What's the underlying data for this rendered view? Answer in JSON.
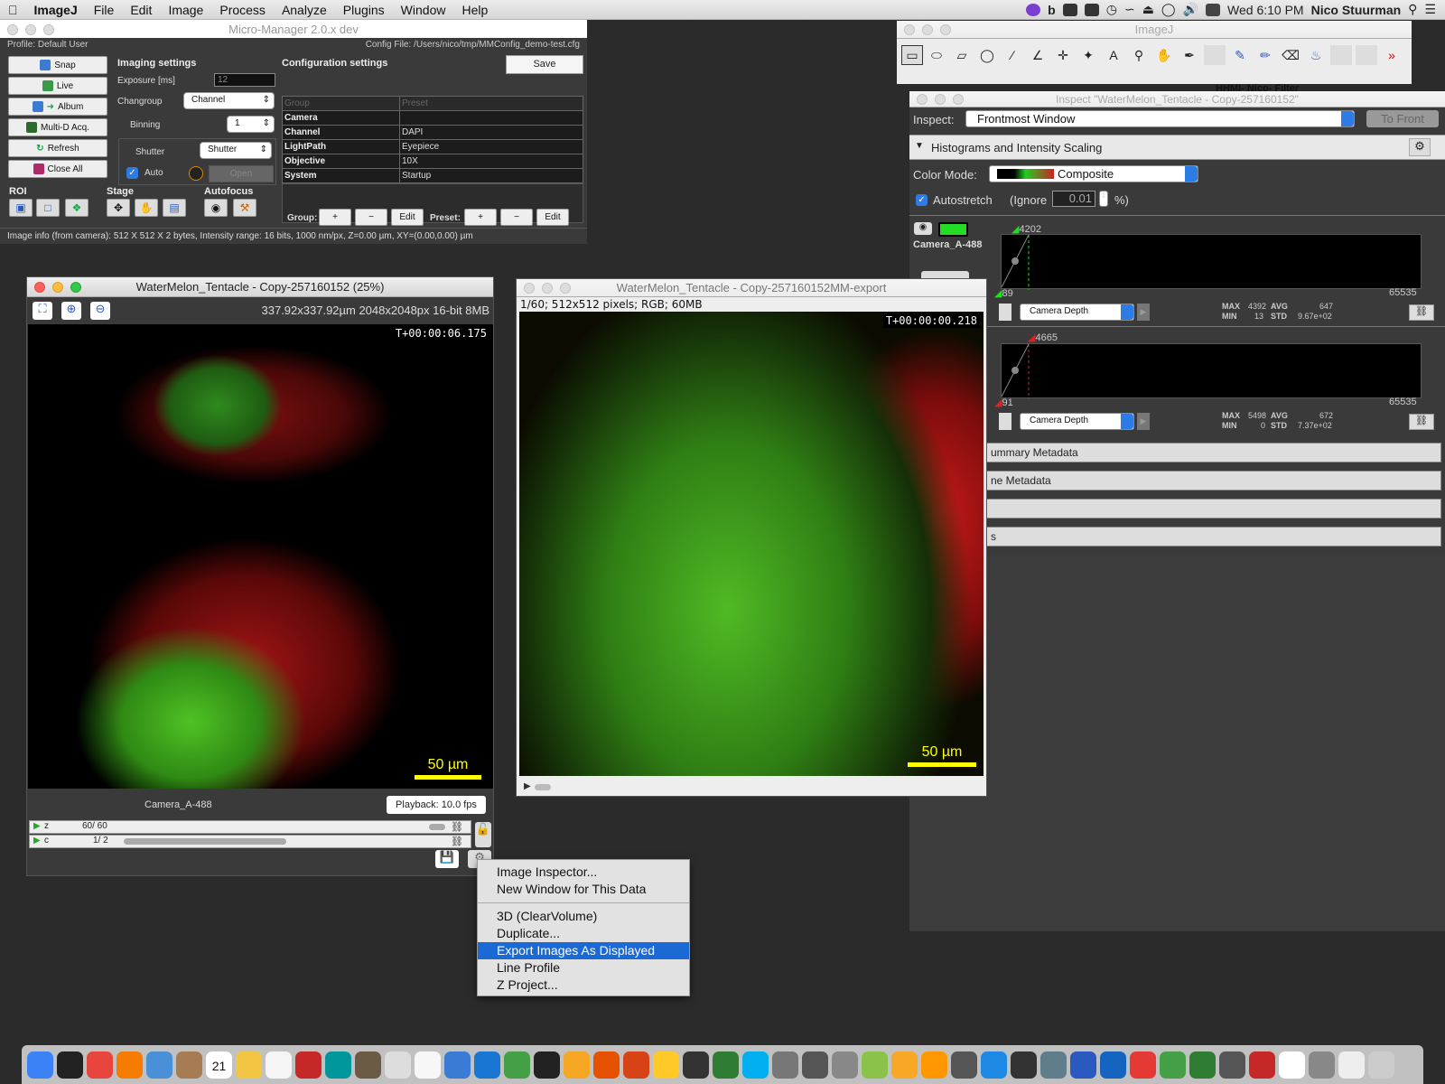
{
  "menubar": {
    "apple": "",
    "app": "ImageJ",
    "items": [
      "File",
      "Edit",
      "Image",
      "Process",
      "Analyze",
      "Plugins",
      "Window",
      "Help"
    ],
    "clock": "Wed 6:10 PM",
    "user": "Nico Stuurman"
  },
  "micromanager": {
    "title": "Micro-Manager 2.0.x dev",
    "profile": "Profile: Default User",
    "config_file": "Config File: /Users/nico/tmp/MMConfig_demo-test.cfg",
    "buttons": {
      "snap": "Snap",
      "live": "Live",
      "album": "Album",
      "mda": "Multi-D Acq.",
      "refresh": "Refresh",
      "close_all": "Close All"
    },
    "imaging_title": "Imaging settings",
    "exposure_label": "Exposure [ms]",
    "exposure_value": "12",
    "changroup_label": "Changroup",
    "changroup_value": "Channel",
    "binning_label": "Binning",
    "binning_value": "1",
    "shutter_label": "Shutter",
    "shutter_value": "Shutter",
    "auto_label": "Auto",
    "open_label": "Open",
    "config_title": "Configuration settings",
    "save_label": "Save",
    "table_header": [
      "Group",
      "Preset"
    ],
    "table_rows": [
      [
        "Camera",
        ""
      ],
      [
        "Channel",
        "DAPI"
      ],
      [
        "LightPath",
        "Eyepiece"
      ],
      [
        "Objective",
        "10X"
      ],
      [
        "System",
        "Startup"
      ]
    ],
    "roi_label": "ROI",
    "stage_label": "Stage",
    "autofocus_label": "Autofocus",
    "group_label": "Group:",
    "preset_label": "Preset:",
    "plus": "+",
    "minus": "−",
    "edit": "Edit",
    "image_info": "Image info (from camera): 512 X 512 X 2 bytes, Intensity range: 16 bits, 1000 nm/px, Z=0.00 µm, XY=(0.00,0.00) µm"
  },
  "imagej": {
    "title": "ImageJ",
    "hhmi_label": "HHMI- Nico- Filter"
  },
  "inspector": {
    "title": "Inspect \"WaterMelon_Tentacle - Copy-257160152\"",
    "inspect_label": "Inspect:",
    "inspect_value": "Frontmost Window",
    "to_front": "To Front",
    "section_hist": "Histograms and Intensity Scaling",
    "color_mode_label": "Color Mode:",
    "color_mode_value": "Composite",
    "autostretch_label": "Autostretch",
    "ignore_label": "(Ignore",
    "ignore_value": "0.01",
    "percent": "%)",
    "channel1": {
      "name": "Camera_A-488",
      "max_top": "4202",
      "min_bottom": "89",
      "range_max": "65535",
      "depth": "Camera Depth",
      "stats_max_label": "MAX",
      "stats_max": "4392",
      "stats_avg_label": "AVG",
      "stats_avg": "647",
      "stats_min_label": "MIN",
      "stats_min": "13",
      "stats_std_label": "STD",
      "stats_std": "9.67e+02",
      "color": "#22dd22"
    },
    "channel2": {
      "max_top": "4665",
      "min_bottom": "91",
      "range_max": "65535",
      "depth": "Camera Depth",
      "stats_max_label": "MAX",
      "stats_max": "5498",
      "stats_avg_label": "AVG",
      "stats_avg": "672",
      "stats_min_label": "MIN",
      "stats_min": "0",
      "stats_std_label": "STD",
      "stats_std": "7.37e+02",
      "color": "#dd2222"
    },
    "collapsed": [
      "ummary Metadata",
      "ne Metadata",
      "",
      "s"
    ]
  },
  "viewer1": {
    "title": "WaterMelon_Tentacle - Copy-257160152 (25%)",
    "info": "337.92x337.92µm  2048x2048px  16-bit 8MB",
    "timestamp": "T+00:00:06.175",
    "scalebar": "50 µm",
    "channel_name": "Camera_A-488",
    "playback": "Playback: 10.0 fps",
    "z_label": "z",
    "z_value": "60/   60",
    "c_label": "c",
    "c_value": "1/    2"
  },
  "viewer2": {
    "title": "WaterMelon_Tentacle - Copy-257160152MM-export",
    "info": "1/60; 512x512 pixels; RGB; 60MB",
    "timestamp": "T+00:00:00.218",
    "scalebar": "50 µm"
  },
  "context_menu": {
    "group1": [
      "Image Inspector...",
      "New Window for This Data"
    ],
    "group2": [
      "3D (ClearVolume)",
      "Duplicate...",
      "Export Images As Displayed",
      "Line Profile",
      "Z Project..."
    ],
    "selected": "Export Images As Displayed"
  },
  "dock": {
    "icons": [
      "finder-icon",
      "launchpad-icon",
      "chrome-icon",
      "firefox-icon",
      "thunderbird-icon",
      "contacts-icon",
      "calendar-icon",
      "photos-icon",
      "textedit-icon",
      "zotero-icon",
      "arduino-icon",
      "gimp-icon",
      "preview-icon",
      "notes-icon",
      "markdown-icon",
      "xcode-icon",
      "numbers-icon",
      "terminal-icon",
      "pages-icon",
      "matlab-icon",
      "app-icon",
      "app-icon",
      "console-icon",
      "activity-icon",
      "skype-icon",
      "app-icon",
      "app-icon",
      "app-icon",
      "android-icon",
      "imagej-icon",
      "micromanager-icon",
      "app-icon",
      "app-icon",
      "app-icon",
      "app-icon",
      "virtualbox-icon",
      "app-icon",
      "app-icon",
      "app-icon",
      "evernote-icon",
      "app-icon",
      "filezilla-icon",
      "java-icon",
      "app-icon",
      "files-icon",
      "trash-icon"
    ],
    "calendar_day": "21"
  }
}
